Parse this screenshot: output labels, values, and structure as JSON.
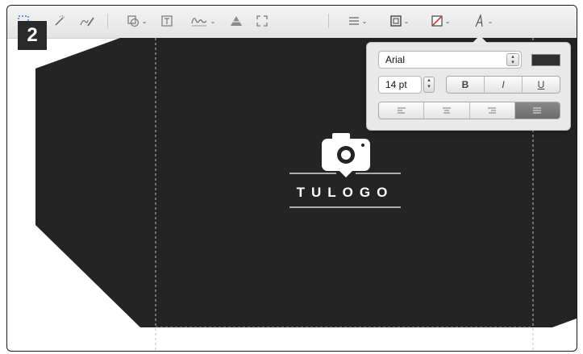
{
  "step_badge": "2",
  "toolbar": {
    "icons": [
      "selection-icon",
      "magic-wand-icon",
      "sketch-pen-icon",
      "shapes-icon",
      "text-box-icon",
      "signature-icon",
      "adjust-color-icon",
      "resize-icon",
      "line-style-icon",
      "border-color-icon",
      "fill-color-icon",
      "text-style-icon"
    ]
  },
  "format_popover": {
    "font_name": "Arial",
    "font_size": "14 pt",
    "style_bold": "B",
    "style_italic": "I",
    "style_underline": "U",
    "text_color": "#2f2f2f",
    "align_options": [
      "left",
      "center",
      "right",
      "justify"
    ],
    "align_selected": "justify"
  },
  "artwork": {
    "logo_text": "TULOGO",
    "fill_color": "#242424"
  }
}
